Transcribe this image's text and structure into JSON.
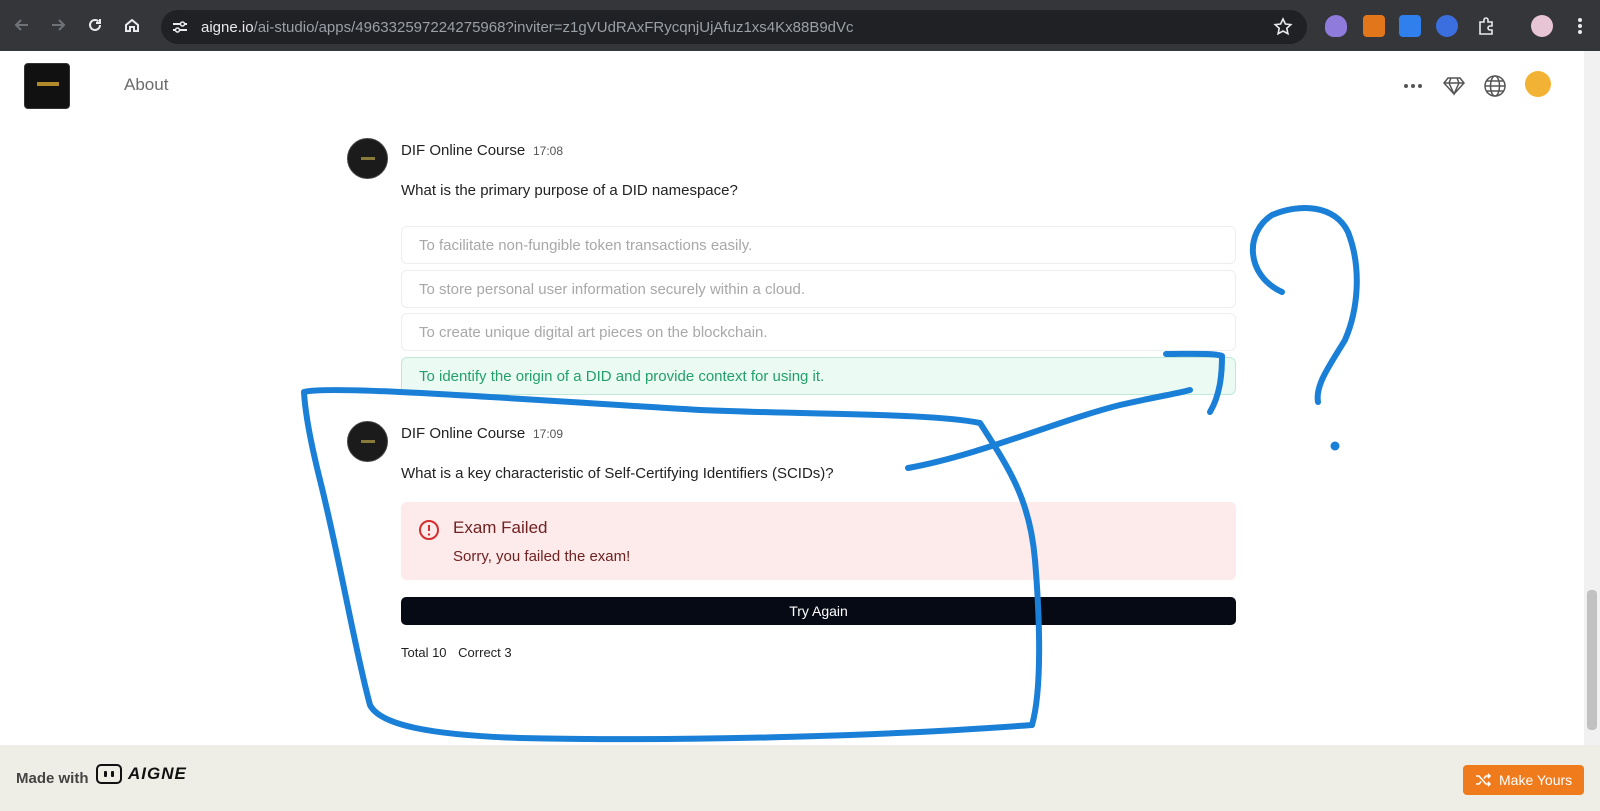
{
  "browser": {
    "url_host": "aigne.io",
    "url_path": "/ai-studio/apps/496332597224275968?inviter=z1gVUdRAxFRycqnjUjAfuz1xs4Kx88B9dVc",
    "icons": [
      "back-icon",
      "forward-icon",
      "reload-icon",
      "home-icon",
      "site-info-icon",
      "bookmark-star-icon",
      "extensions-icon",
      "menu-icon"
    ]
  },
  "header": {
    "about_label": "About",
    "icons": [
      "more-icon",
      "diamond-icon",
      "globe-icon",
      "user-avatar"
    ]
  },
  "messages": [
    {
      "author": "DIF Online Course",
      "time": "17:08",
      "question": "What is the primary purpose of a DID namespace?",
      "options": [
        "To facilitate non-fungible token transactions easily.",
        "To store personal user information securely within a cloud.",
        "To create unique digital art pieces on the blockchain.",
        "To identify the origin of a DID and provide context for using it."
      ],
      "correct_index": 3
    },
    {
      "author": "DIF Online Course",
      "time": "17:09",
      "question": "What is a key characteristic of Self-Certifying Identifiers (SCIDs)?"
    }
  ],
  "result": {
    "alert_title": "Exam Failed",
    "alert_body": "Sorry, you failed the exam!",
    "button_label": "Try Again",
    "total_label": "Total 10",
    "correct_label": "Correct 3"
  },
  "footer": {
    "made_with": "Made with",
    "brand": "AIGNE",
    "make_yours": "Make Yours"
  },
  "colors": {
    "annotation_ink": "#1a7fd6",
    "correct_green": "#22a06b",
    "accent_orange": "#f07b1d"
  }
}
